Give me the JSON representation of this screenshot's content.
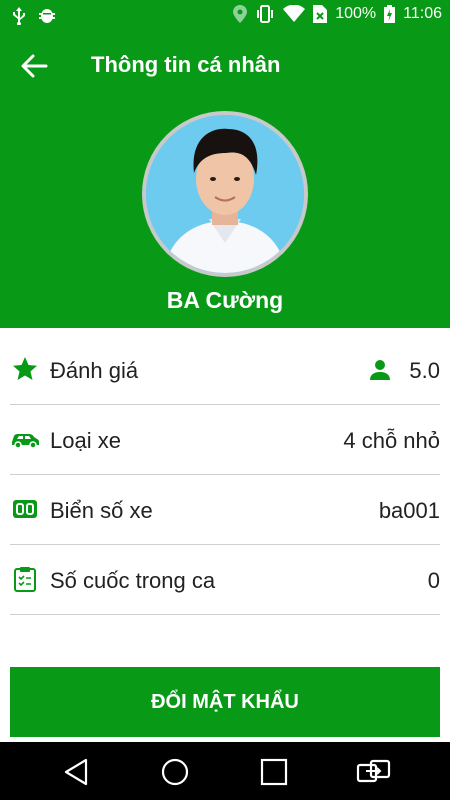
{
  "status_bar": {
    "battery": "100%",
    "time": "11:06",
    "icons": [
      "usb-icon",
      "android-debug-icon",
      "location-icon",
      "vibrate-icon",
      "wifi-icon",
      "no-sim-icon",
      "battery-icon"
    ]
  },
  "app_bar": {
    "title": "Thông tin cá nhân"
  },
  "profile": {
    "name": "BA Cường"
  },
  "info_rows": [
    {
      "icon": "star-icon",
      "label": "Đánh giá",
      "value": "5.0"
    },
    {
      "icon": "car-icon",
      "label": "Loại xe",
      "value": "4 chỗ nhỏ"
    },
    {
      "icon": "license-plate-icon",
      "label": "Biển số xe",
      "value": "ba001"
    },
    {
      "icon": "clipboard-icon",
      "label": "Số cuốc trong ca",
      "value": "0"
    }
  ],
  "actions": {
    "change_password": "ĐỔI MẬT KHẨU"
  },
  "colors": {
    "primary": "#089a16",
    "divider": "#cfcfcf",
    "nav_background": "#000000"
  }
}
